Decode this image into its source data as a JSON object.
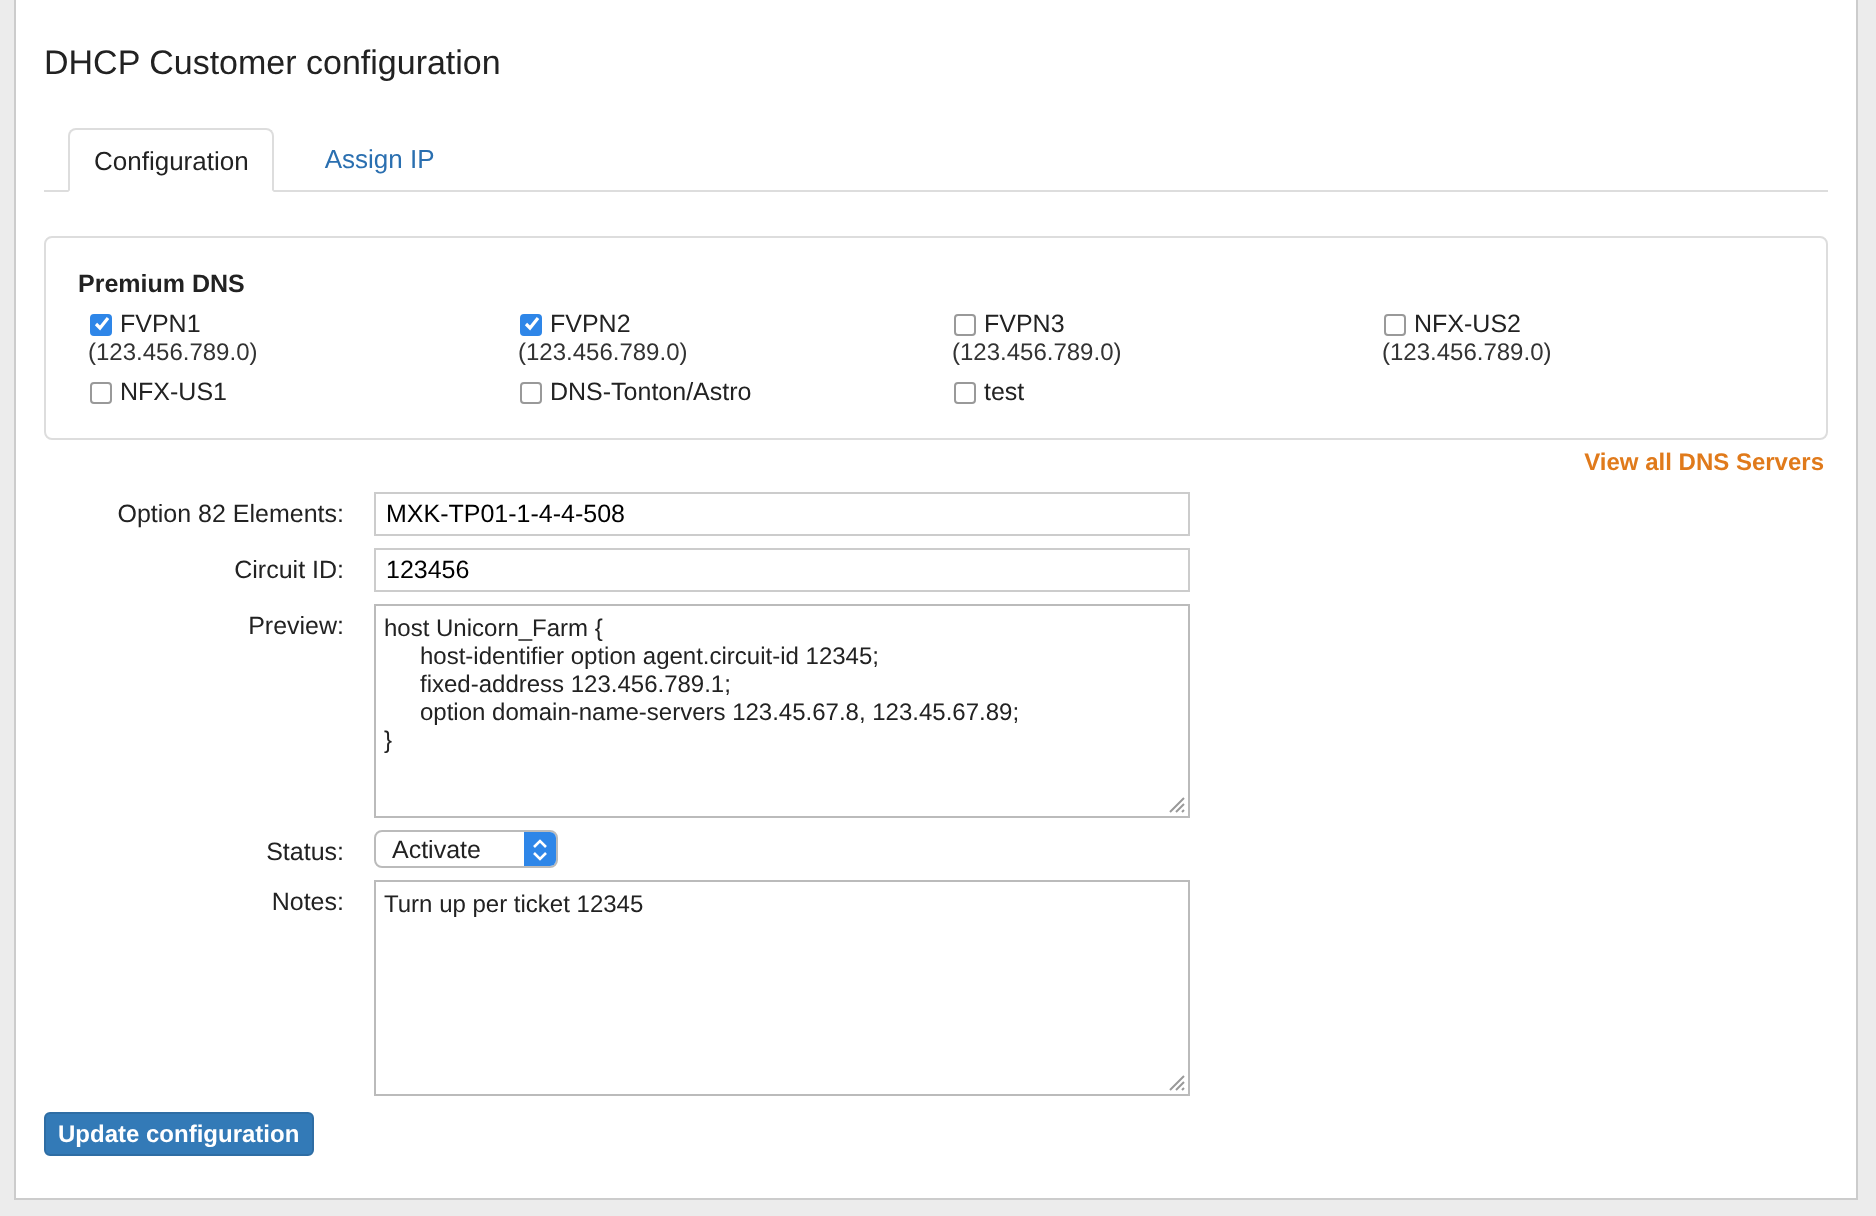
{
  "title": "DHCP Customer configuration",
  "tabs": [
    {
      "label": "Configuration",
      "selected": true
    },
    {
      "label": "Assign IP",
      "selected": false
    }
  ],
  "premium_dns": {
    "heading": "Premium DNS",
    "servers": [
      {
        "name": "FVPN1",
        "address": "(123.456.789.0)",
        "checked": true
      },
      {
        "name": "FVPN2",
        "address": "(123.456.789.0)",
        "checked": true
      },
      {
        "name": "FVPN3",
        "address": "(123.456.789.0)",
        "checked": false
      },
      {
        "name": "NFX-US2",
        "address": "(123.456.789.0)",
        "checked": false
      },
      {
        "name": "NFX-US1",
        "checked": false
      },
      {
        "name": "DNS-Tonton/Astro",
        "checked": false
      },
      {
        "name": "test",
        "checked": false
      }
    ],
    "link": "View all DNS Servers"
  },
  "form": {
    "option82": {
      "label": "Option 82 Elements:",
      "value": "MXK-TP01-1-4-4-508"
    },
    "circuit_id": {
      "label": "Circuit ID:",
      "value": "123456"
    },
    "preview": {
      "label": "Preview:",
      "lines": [
        {
          "text": "host Unicorn_Farm {",
          "children": [
            {
              "text": "host-identifier option agent.circuit-id 12345;"
            },
            {
              "text": "fixed-address 123.456.789.1;"
            },
            {
              "text": "option domain-name-servers 123.45.67.8, 123.45.67.89;"
            }
          ]
        },
        {
          "text": "}"
        }
      ]
    },
    "status": {
      "label": "Status:",
      "value": "Activate"
    },
    "notes": {
      "label": "Notes:",
      "value": "Turn up per ticket 12345"
    }
  },
  "submit": "Update configuration"
}
